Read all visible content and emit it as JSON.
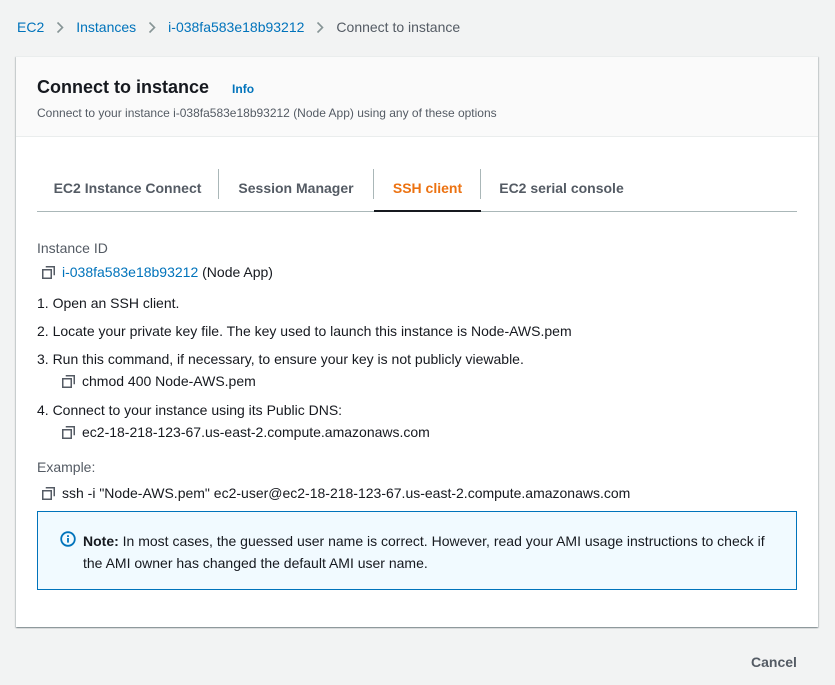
{
  "breadcrumb": {
    "items": [
      "EC2",
      "Instances",
      "i-038fa583e18b93212",
      "Connect to instance"
    ]
  },
  "panel": {
    "title": "Connect to instance",
    "info_label": "Info",
    "description": "Connect to your instance i-038fa583e18b93212 (Node App) using any of these options"
  },
  "tabs": [
    {
      "label": "EC2 Instance Connect",
      "active": false
    },
    {
      "label": "Session Manager",
      "active": false
    },
    {
      "label": "SSH client",
      "active": true
    },
    {
      "label": "EC2 serial console",
      "active": false
    }
  ],
  "ssh": {
    "instance_id_label": "Instance ID",
    "instance_id": "i-038fa583e18b93212",
    "instance_name": " (Node App)",
    "step1": "1. Open an SSH client.",
    "step2": "2. Locate your private key file. The key used to launch this instance is Node-AWS.pem",
    "step3": "3. Run this command, if necessary, to ensure your key is not publicly viewable.",
    "step3_command": "chmod 400 Node-AWS.pem",
    "step4": "4. Connect to your instance using its Public DNS:",
    "step4_dns": "ec2-18-218-123-67.us-east-2.compute.amazonaws.com",
    "example_label": "Example:",
    "example_command": "ssh -i \"Node-AWS.pem\" ec2-user@ec2-18-218-123-67.us-east-2.compute.amazonaws.com"
  },
  "note": {
    "bold": "Note:",
    "text": " In most cases, the guessed user name is correct. However, read your AMI usage instructions to check if the AMI owner has changed the default AMI user name."
  },
  "footer": {
    "cancel_label": "Cancel"
  },
  "colors": {
    "link": "#0073bb",
    "active_tab": "#ec7211",
    "note_bg": "#f1faff",
    "note_border": "#0073bb"
  }
}
